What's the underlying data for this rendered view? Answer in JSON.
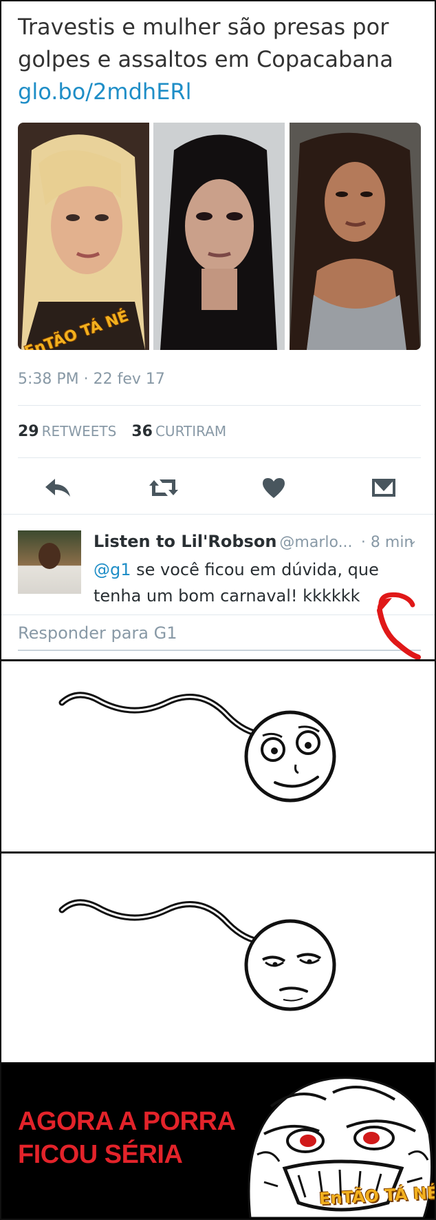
{
  "tweet": {
    "text": "Travestis e mulher são presas por golpes e assaltos em Copacabana",
    "link": "glo.bo/2mdhERl",
    "watermark": "EnTÃO TÁ NÉ",
    "timestamp": "5:38 PM · 22 fev 17",
    "retweets_count": "29",
    "retweets_label": "RETWEETS",
    "likes_count": "36",
    "likes_label": "CURTIRAM",
    "icons": [
      "reply-icon",
      "retweet-icon",
      "heart-icon",
      "message-icon"
    ]
  },
  "reply": {
    "name": "Listen to Lil'Robson",
    "handle": "@marlo...",
    "time": "· 8 min",
    "mention": "@g1",
    "text": " se você ficou em dúvida, que tenha um bom carnaval! kkkkkk",
    "respond_placeholder": "Responder para G1"
  },
  "meme": {
    "caption": "AGORA A PORRA FICOU SÉRIA",
    "logo": "EnTÃO TÁ NÉ",
    "colors": {
      "caption": "#e3232a",
      "logo": "#f2b01e"
    }
  }
}
